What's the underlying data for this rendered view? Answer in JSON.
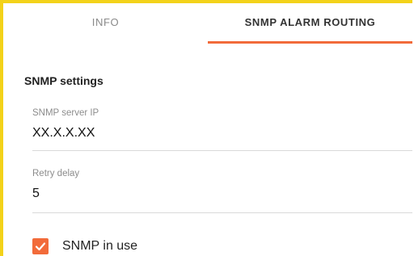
{
  "tabs": [
    {
      "label": "INFO",
      "active": false
    },
    {
      "label": "SNMP ALARM ROUTING",
      "active": true
    }
  ],
  "section": {
    "title": "SNMP settings"
  },
  "fields": {
    "server_ip": {
      "label": "SNMP server IP",
      "value": "XX.X.X.XX"
    },
    "retry_delay": {
      "label": "Retry delay",
      "value": "5"
    }
  },
  "snmp_in_use": {
    "label": "SNMP in use",
    "checked": true
  },
  "colors": {
    "accent": "#f26b3a",
    "frame": "#f3d21a"
  },
  "icons": {
    "checkbox": "check-icon"
  }
}
